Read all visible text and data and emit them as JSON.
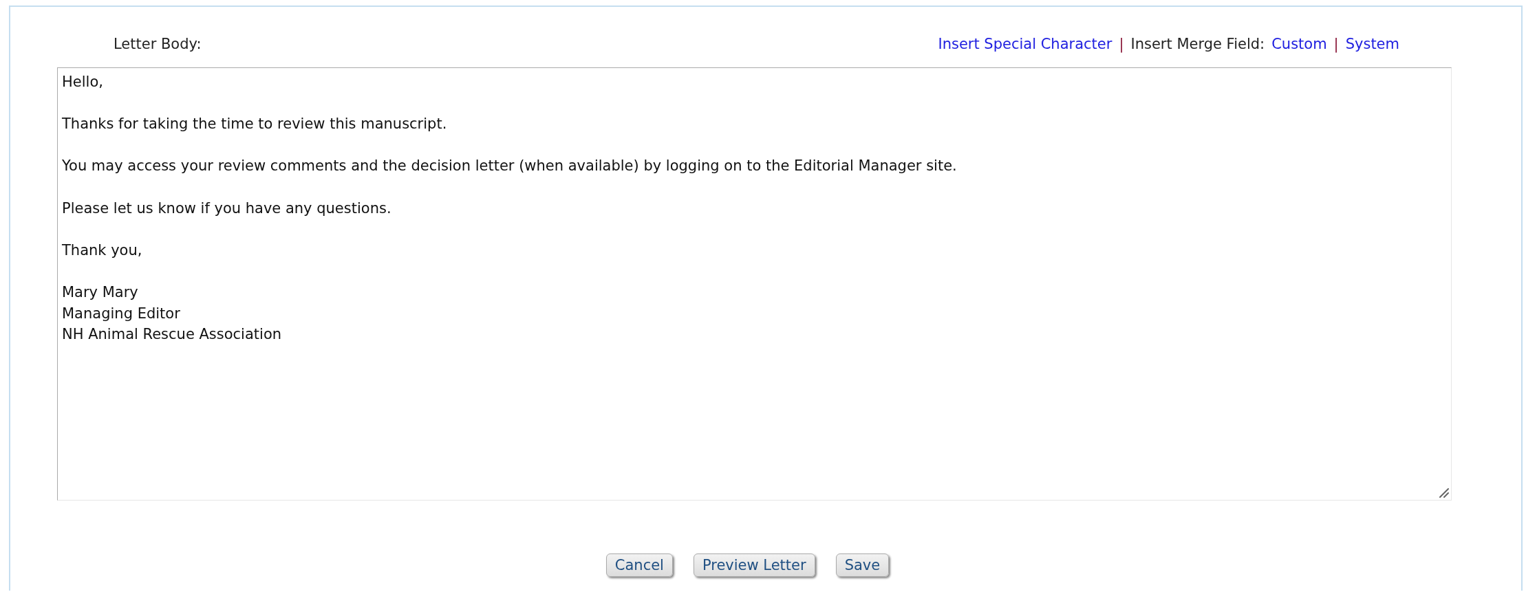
{
  "label": "Letter Body:",
  "toolbar": [
    {
      "kind": "link",
      "text": "Insert Special Character"
    },
    {
      "kind": "separator",
      "text": "|"
    },
    {
      "kind": "label",
      "text": "Insert Merge Field:"
    },
    {
      "kind": "link",
      "text": "Custom"
    },
    {
      "kind": "separator",
      "text": "|"
    },
    {
      "kind": "link",
      "text": "System"
    }
  ],
  "body": {
    "value": "Hello,\n\nThanks for taking the time to review this manuscript.\n\nYou may access your review comments and the decision letter (when available) by logging on to the Editorial Manager site.\n\nPlease let us know if you have any questions.\n\nThank you,\n\nMary Mary\nManaging Editor\nNH Animal Rescue Association"
  },
  "buttons": [
    "Cancel",
    "Preview Letter",
    "Save"
  ]
}
